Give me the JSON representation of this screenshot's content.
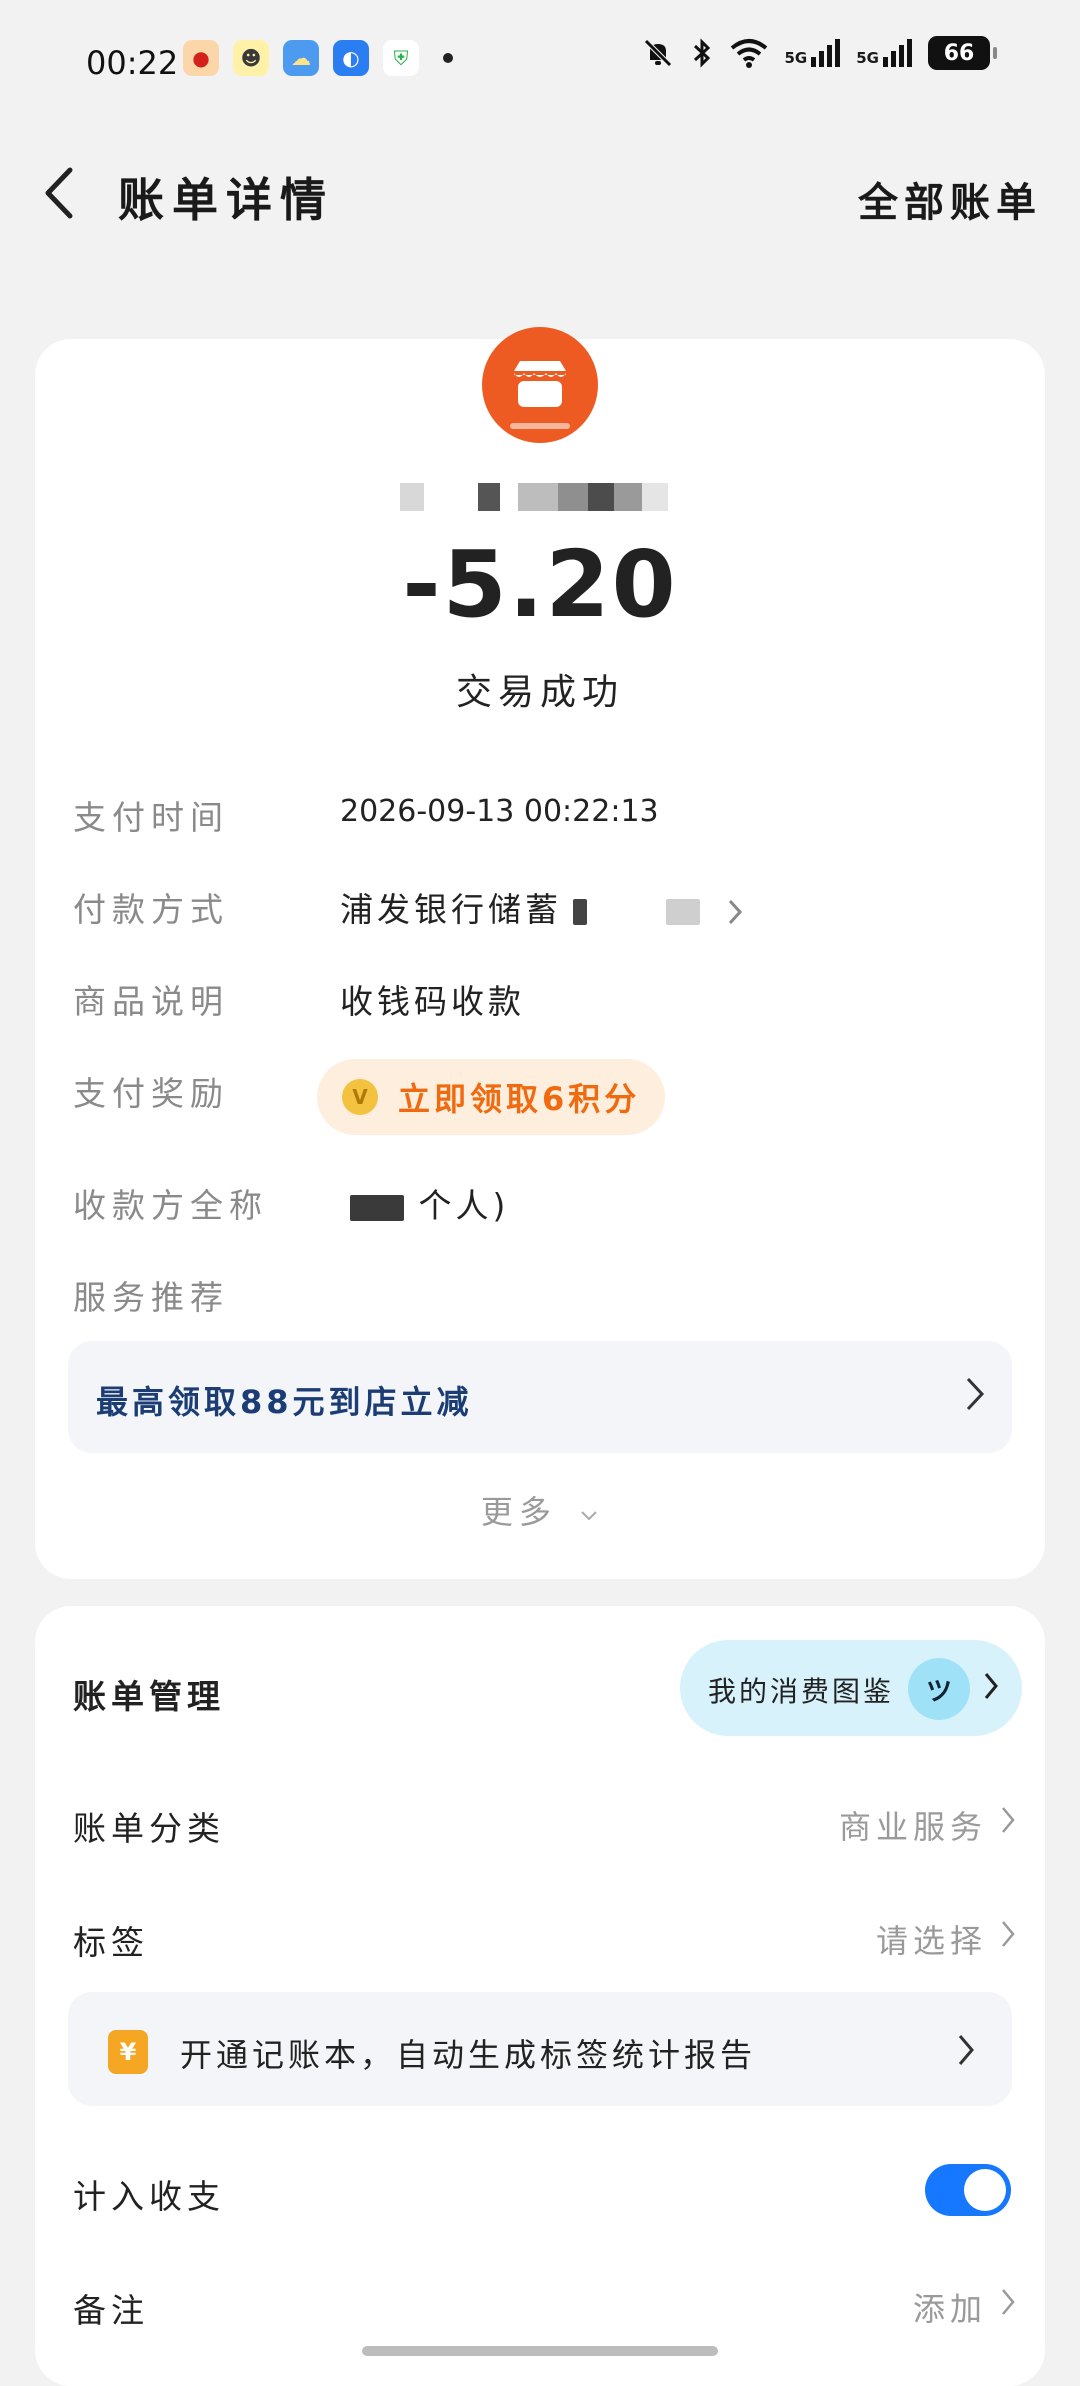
{
  "status_bar": {
    "time": "00:22",
    "signal_1": "5G",
    "signal_2": "5G",
    "battery": "66",
    "app_icons": [
      "weibo-icon",
      "assistant-icon",
      "weather-icon",
      "browser-icon",
      "security-icon"
    ]
  },
  "header": {
    "title": "账单详情",
    "all_bills": "全部账单"
  },
  "summary": {
    "amount": "-5.20",
    "status": "交易成功",
    "accent_color": "#ee5b22"
  },
  "details": {
    "pay_time_label": "支付时间",
    "pay_time_value": "2026-09-13 00:22:13",
    "pay_method_label": "付款方式",
    "pay_method_value": "浦发银行储蓄",
    "product_label": "商品说明",
    "product_value": "收钱码收款",
    "reward_label": "支付奖励",
    "reward_value": "立即领取6积分",
    "payee_label": "收款方全称",
    "payee_value_suffix": "个人)",
    "service_label": "服务推荐"
  },
  "promo": {
    "text": "最高领取88元到店立减",
    "more": "更多"
  },
  "management": {
    "title": "账单管理",
    "insight_label": "我的消费图鉴",
    "category_label": "账单分类",
    "category_value": "商业服务",
    "tag_label": "标签",
    "tag_value": "请选择",
    "book_banner_text": "开通记账本，自动生成标签统计报告",
    "count_label": "计入收支",
    "count_enabled": true,
    "note_label": "备注",
    "note_value": "添加"
  }
}
